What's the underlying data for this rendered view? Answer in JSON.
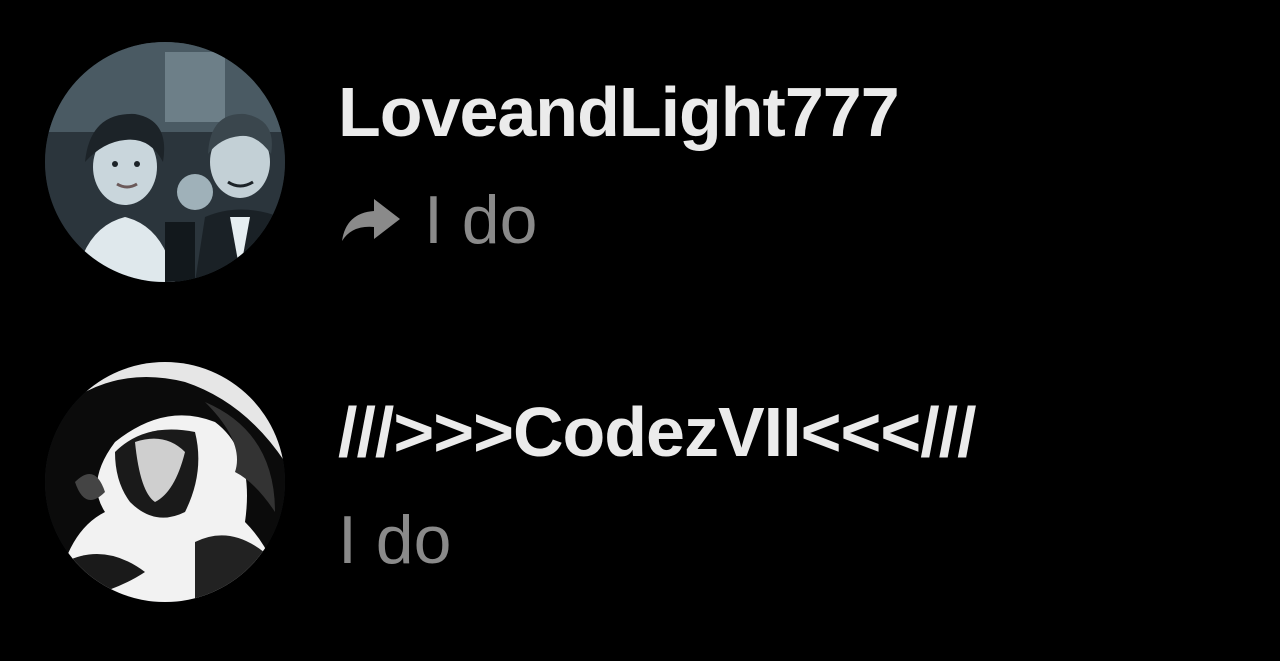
{
  "comments": [
    {
      "username": "LoveandLight777",
      "is_reply": true,
      "reply_icon": "reply-arrow-icon",
      "text": "I do",
      "avatar_desc": "avatar-photo"
    },
    {
      "username": "///>>>CodezVII<<</// ",
      "is_reply": false,
      "text": "I do",
      "avatar_desc": "avatar-photo"
    }
  ],
  "colors": {
    "background": "#000000",
    "username": "#ebebeb",
    "body_text": "#8a8a8a",
    "icon": "#8a8a8a"
  }
}
